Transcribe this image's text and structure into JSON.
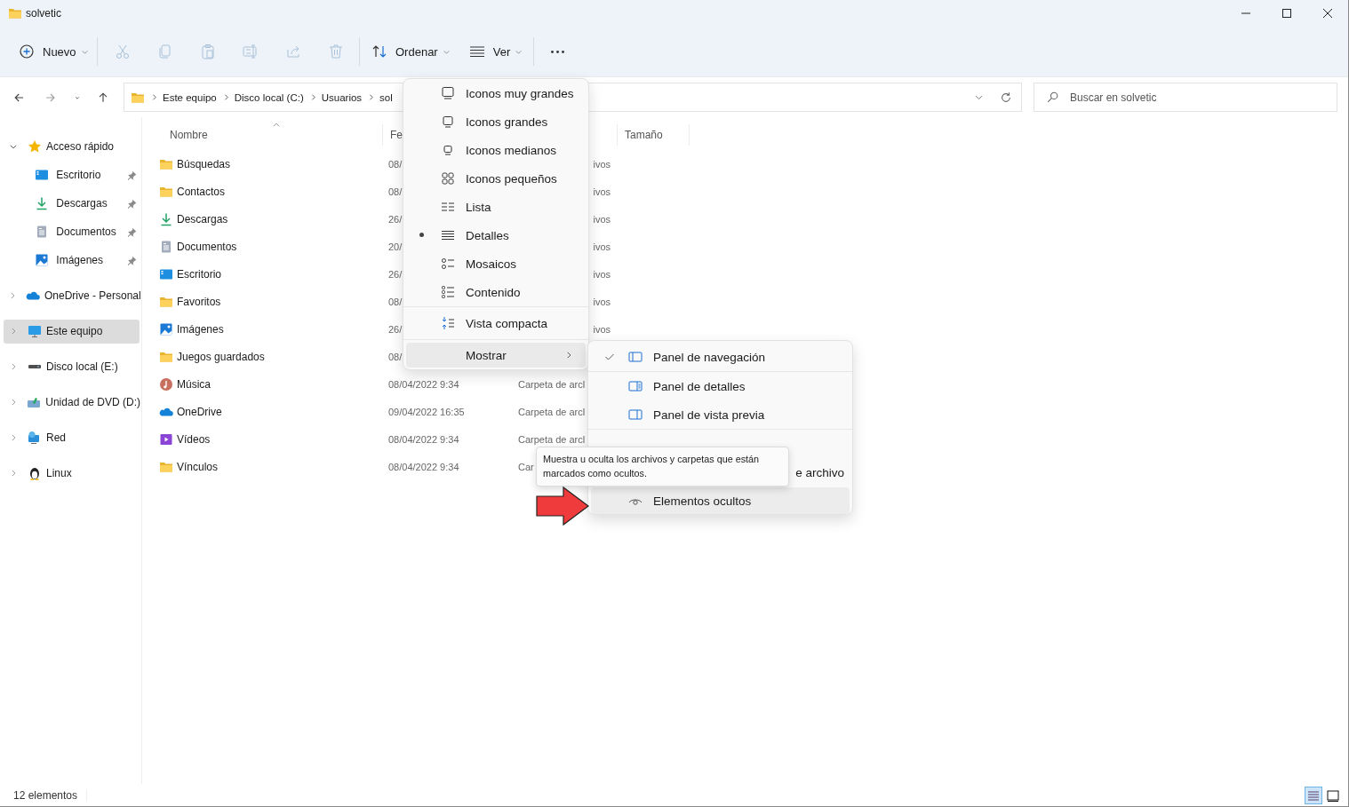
{
  "window": {
    "title": "solvetic"
  },
  "toolbar": {
    "groups": [
      [
        {
          "kind": "new",
          "label": "Nuevo",
          "disabled": false
        }
      ],
      [
        {
          "kind": "cut",
          "disabled": true
        },
        {
          "kind": "copy",
          "disabled": true
        },
        {
          "kind": "paste",
          "disabled": true
        },
        {
          "kind": "rename",
          "disabled": true
        },
        {
          "kind": "share",
          "disabled": true
        },
        {
          "kind": "delete",
          "disabled": true
        }
      ],
      [
        {
          "kind": "sort",
          "label": "Ordenar",
          "disabled": false
        },
        {
          "kind": "view",
          "label": "Ver",
          "disabled": false
        }
      ],
      [
        {
          "kind": "more",
          "disabled": false
        }
      ]
    ]
  },
  "navigation": {
    "buttons": [
      {
        "kind": "back",
        "disabled": false
      },
      {
        "kind": "forward",
        "disabled": true
      },
      {
        "kind": "recent",
        "disabled": false
      },
      {
        "kind": "up",
        "disabled": false
      }
    ]
  },
  "address": {
    "crumbs": [
      "Este equipo",
      "Disco local (C:)",
      "Usuarios",
      "sol"
    ]
  },
  "search": {
    "placeholder": "Buscar en solvetic"
  },
  "sidebar": {
    "items": [
      {
        "kind": "star",
        "label": "Acceso rápido",
        "expanded": true,
        "selected": false,
        "children": [
          {
            "kind": "desktop",
            "label": "Escritorio",
            "pinned": true,
            "selected": false
          },
          {
            "kind": "download",
            "label": "Descargas",
            "pinned": true,
            "selected": false
          },
          {
            "kind": "document",
            "label": "Documentos",
            "pinned": true,
            "selected": false
          },
          {
            "kind": "pictures",
            "label": "Imágenes",
            "pinned": true,
            "selected": false
          }
        ]
      },
      {
        "kind": "cloud",
        "label": "OneDrive - Personal",
        "expanded": false,
        "selected": false
      },
      {
        "kind": "computer",
        "label": "Este equipo",
        "expanded": false,
        "selected": true
      },
      {
        "kind": "drive",
        "label": "Disco local (E:)",
        "expanded": false,
        "selected": false
      },
      {
        "kind": "dvd",
        "label": "Unidad de DVD (D:)",
        "expanded": false,
        "selected": false
      },
      {
        "kind": "network",
        "label": "Red",
        "expanded": false,
        "selected": false
      },
      {
        "kind": "penguin",
        "label": "Linux",
        "expanded": false,
        "selected": false
      }
    ]
  },
  "file_list": {
    "columns": [
      {
        "kind": "name",
        "label": "Nombre",
        "sorted": true
      },
      {
        "kind": "date",
        "label": "Fe"
      },
      {
        "kind": "size",
        "label": "Tamaño",
        "sorted": false
      }
    ],
    "rows": [
      {
        "kind": "folder",
        "name": "Búsquedas",
        "date": "08/",
        "type": "ivos"
      },
      {
        "kind": "folder",
        "name": "Contactos",
        "date": "08/",
        "type": "ivos"
      },
      {
        "kind": "download",
        "name": "Descargas",
        "date": "26/",
        "type": "ivos"
      },
      {
        "kind": "document",
        "name": "Documentos",
        "date": "20/",
        "type": "ivos"
      },
      {
        "kind": "desktop",
        "name": "Escritorio",
        "date": "26/",
        "type": "ivos"
      },
      {
        "kind": "folder",
        "name": "Favoritos",
        "date": "08/",
        "type": "ivos"
      },
      {
        "kind": "pictures",
        "name": "Imágenes",
        "date": "26/",
        "type": "ivos"
      },
      {
        "kind": "folder",
        "name": "Juegos guardados",
        "date": "08/"
      },
      {
        "kind": "music",
        "name": "Música",
        "date": "08/04/2022 9:34",
        "type": "Carpeta de arcl"
      },
      {
        "kind": "cloud",
        "name": "OneDrive",
        "date": "09/04/2022 16:35",
        "type": "Carpeta de arcl"
      },
      {
        "kind": "videos",
        "name": "Vídeos",
        "date": "08/04/2022 9:34",
        "type": "Carpeta de arcl"
      },
      {
        "kind": "folder",
        "name": "Vínculos",
        "date": "08/04/2022 9:34",
        "type": "Car"
      }
    ]
  },
  "view_menu": {
    "layouts": [
      {
        "kind": "xl",
        "label": "Iconos muy grandes",
        "selected": false
      },
      {
        "kind": "large",
        "label": "Iconos grandes",
        "selected": false
      },
      {
        "kind": "medium",
        "label": "Iconos medianos",
        "selected": false
      },
      {
        "kind": "small",
        "label": "Iconos pequeños",
        "selected": false
      },
      {
        "kind": "list",
        "label": "Lista",
        "selected": false
      },
      {
        "kind": "details",
        "label": "Detalles",
        "selected": true
      },
      {
        "kind": "tiles",
        "label": "Mosaicos",
        "selected": false
      },
      {
        "kind": "content",
        "label": "Contenido",
        "selected": false
      }
    ],
    "compact": {
      "label": "Vista compacta"
    },
    "show": {
      "label": "Mostrar",
      "expanded": true
    }
  },
  "show_submenu": {
    "items": [
      {
        "kind": "nav_pane",
        "label": "Panel de navegación",
        "checked": true,
        "highlighted": false
      },
      {
        "kind": "details_pane",
        "label": "Panel de detalles",
        "checked": false,
        "highlighted": false
      },
      {
        "kind": "preview_pane",
        "label": "Panel de vista previa",
        "checked": false,
        "highlighted": false
      },
      {
        "kind": "extensions",
        "label": "e archivo",
        "highlighted": false
      },
      {
        "kind": "hidden_items",
        "label": "Elementos ocultos",
        "checked": false,
        "highlighted": true
      }
    ]
  },
  "tooltip": {
    "text": "Muestra u oculta los archivos y carpetas que están marcados como ocultos."
  },
  "status_bar": {
    "count": "12 elementos",
    "view_buttons": [
      {
        "kind": "details",
        "selected": true
      },
      {
        "kind": "large_icons",
        "selected": false
      }
    ]
  }
}
